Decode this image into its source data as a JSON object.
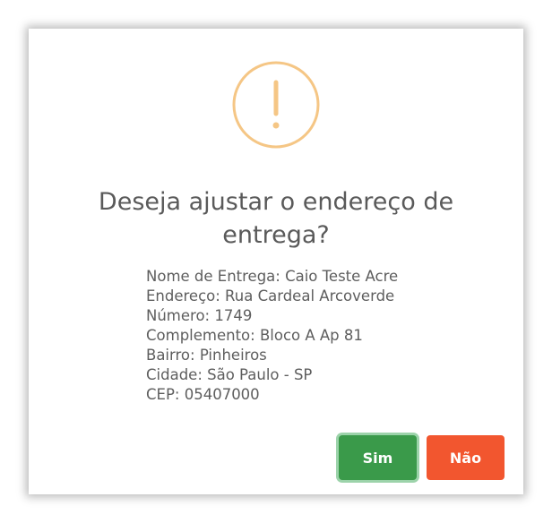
{
  "dialog": {
    "title": "Deseja ajustar o endereço de entrega?",
    "icon": "exclamation-circle-icon",
    "accent_color": "#f5c685",
    "details": [
      "Nome de Entrega: Caio Teste Acre",
      "Endereço: Rua Cardeal Arcoverde",
      "Número: 1749",
      "Complemento: Bloco A Ap 81",
      "Bairro: Pinheiros",
      "Cidade: São Paulo - SP",
      "CEP: 05407000"
    ],
    "buttons": {
      "confirm_label": "Sim",
      "confirm_color": "#3a9a4a",
      "cancel_label": "Não",
      "cancel_color": "#f2562f"
    }
  }
}
